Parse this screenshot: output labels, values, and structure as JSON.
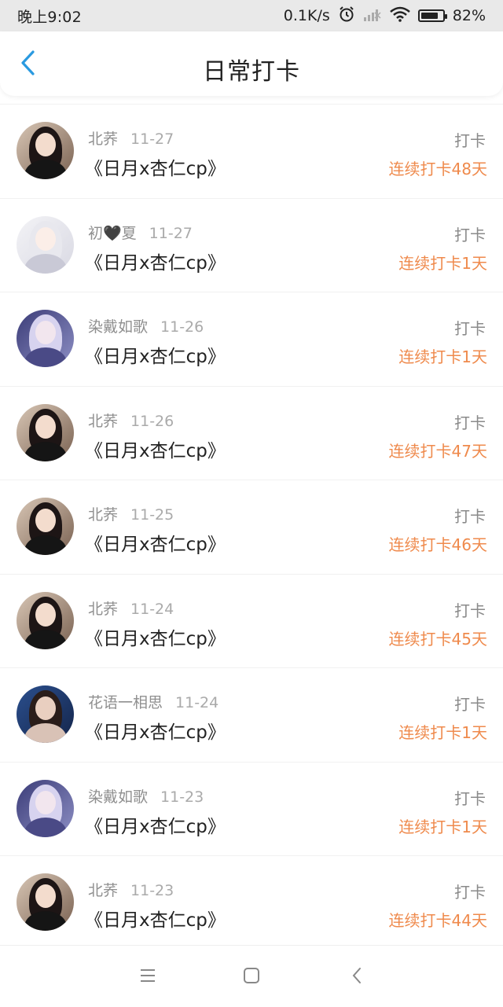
{
  "status_bar": {
    "time": "晚上9:02",
    "network_speed": "0.1K/s",
    "battery_percent": "82%",
    "battery_level": 0.82,
    "icons": [
      "alarm-icon",
      "signal-icon",
      "wifi-icon",
      "battery-icon"
    ]
  },
  "header": {
    "title": "日常打卡",
    "back_icon": "chevron-left-icon",
    "accent_color": "#2a9ae0"
  },
  "items": [
    {
      "user": "北荞",
      "date": "11-27",
      "topic": "《日月x杏仁cp》",
      "action": "打卡",
      "streak": "连续打卡48天",
      "avatar": "portrait-girl-dark-hair"
    },
    {
      "user": "初🖤夏",
      "date": "11-27",
      "topic": "《日月x杏仁cp》",
      "action": "打卡",
      "streak": "连续打卡1天",
      "avatar": "anime-girl-white-hair"
    },
    {
      "user": "染戴如歌",
      "date": "11-26",
      "topic": "《日月x杏仁cp》",
      "action": "打卡",
      "streak": "连续打卡1天",
      "avatar": "anime-girl-purple"
    },
    {
      "user": "北荞",
      "date": "11-26",
      "topic": "《日月x杏仁cp》",
      "action": "打卡",
      "streak": "连续打卡47天",
      "avatar": "portrait-girl-dark-hair"
    },
    {
      "user": "北荞",
      "date": "11-25",
      "topic": "《日月x杏仁cp》",
      "action": "打卡",
      "streak": "连续打卡46天",
      "avatar": "portrait-girl-dark-hair"
    },
    {
      "user": "北荞",
      "date": "11-24",
      "topic": "《日月x杏仁cp》",
      "action": "打卡",
      "streak": "连续打卡45天",
      "avatar": "portrait-girl-dark-hair"
    },
    {
      "user": "花语一相思",
      "date": "11-24",
      "topic": "《日月x杏仁cp》",
      "action": "打卡",
      "streak": "连续打卡1天",
      "avatar": "portrait-blue-background"
    },
    {
      "user": "染戴如歌",
      "date": "11-23",
      "topic": "《日月x杏仁cp》",
      "action": "打卡",
      "streak": "连续打卡1天",
      "avatar": "anime-girl-purple"
    },
    {
      "user": "北荞",
      "date": "11-23",
      "topic": "《日月x杏仁cp》",
      "action": "打卡",
      "streak": "连续打卡44天",
      "avatar": "portrait-girl-dark-hair"
    }
  ],
  "colors": {
    "streak": "#ef8a4c",
    "username": "#8f8f8f",
    "date": "#aaaaaa",
    "topic": "#222222"
  },
  "nav_bar": {
    "icons": [
      "menu-icon",
      "home-square-icon",
      "back-icon"
    ]
  }
}
